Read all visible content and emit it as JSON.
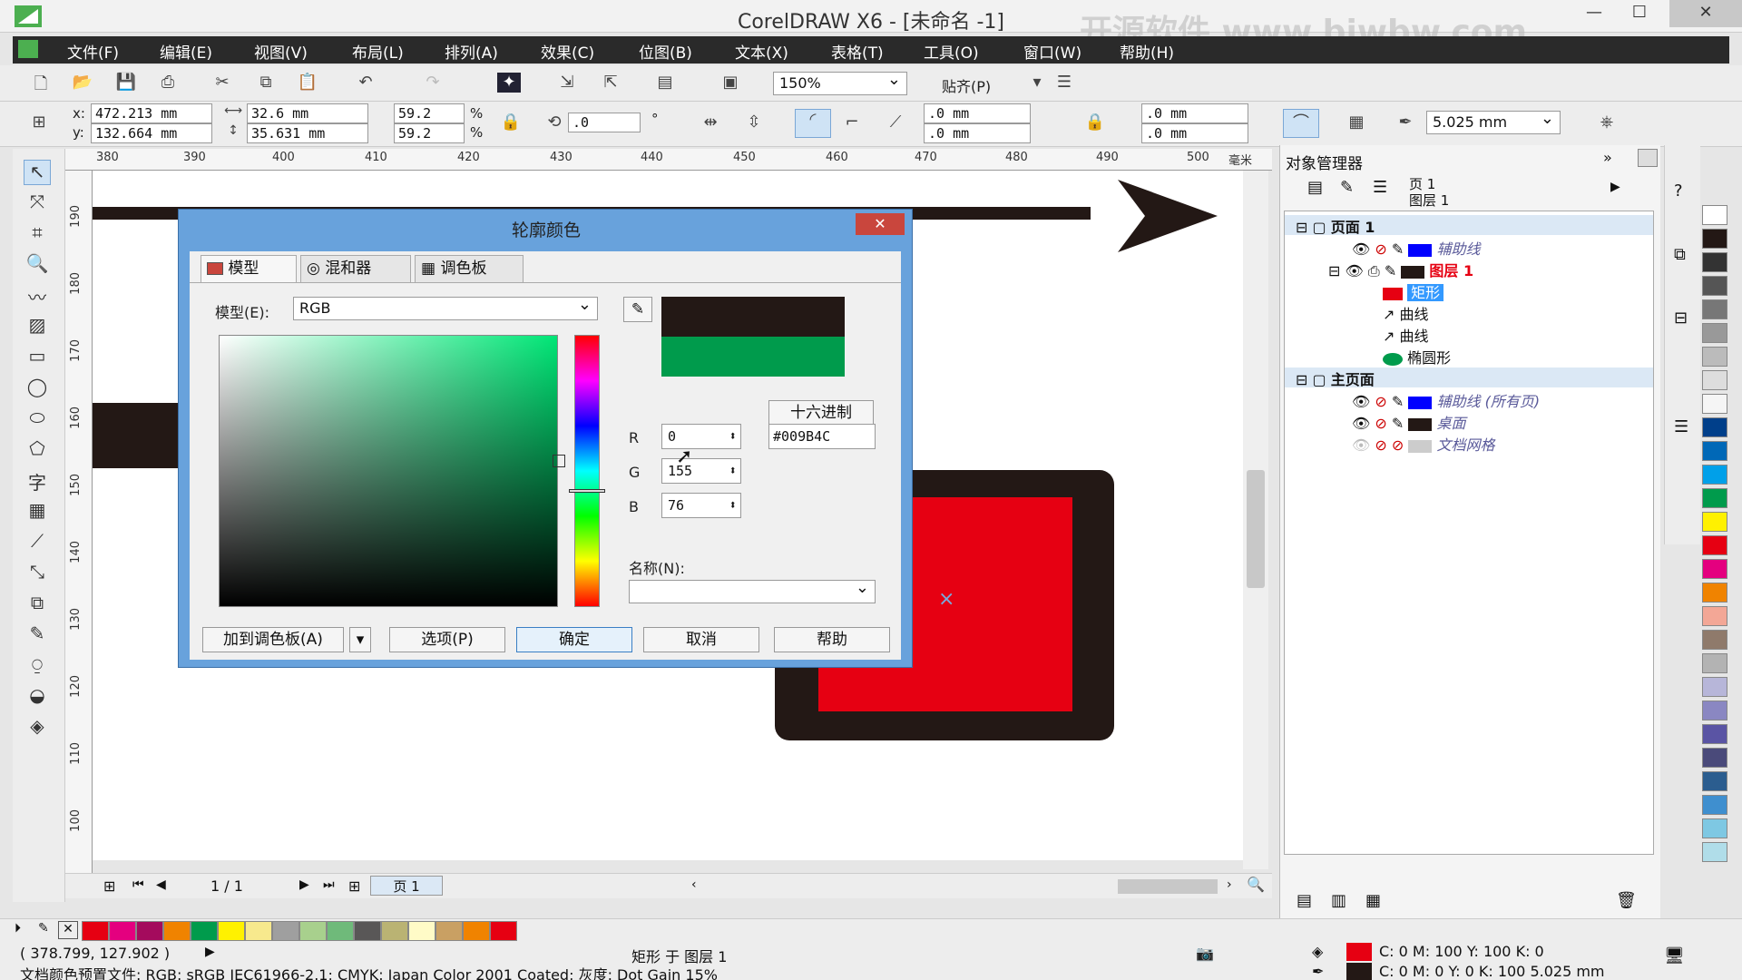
{
  "window": {
    "title": "CorelDRAW X6 - [未命名 -1]",
    "watermark": "开源软件 www.bjwbw.com"
  },
  "menu": [
    "文件(F)",
    "编辑(E)",
    "视图(V)",
    "布局(L)",
    "排列(A)",
    "效果(C)",
    "位图(B)",
    "文本(X)",
    "表格(T)",
    "工具(O)",
    "窗口(W)",
    "帮助(H)"
  ],
  "toolbar": {
    "zoom": "150%",
    "snap_label": "贴齐(P)"
  },
  "props": {
    "x": "472.213 mm",
    "y": "132.664 mm",
    "w": "32.6 mm",
    "h": "35.631 mm",
    "scale_x": "59.2",
    "scale_y": "59.2",
    "pct": "%",
    "angle": ".0",
    "deg": "°",
    "corner1": ".0 mm",
    "corner2": ".0 mm",
    "corner3": ".0 mm",
    "corner4": ".0 mm",
    "outline_width": "5.025 mm",
    "x_label": "x:",
    "y_label": "y:"
  },
  "ruler_h": [
    "380",
    "390",
    "400",
    "410",
    "420",
    "430",
    "440",
    "450",
    "460",
    "470",
    "480",
    "490",
    "500",
    "毫米"
  ],
  "ruler_v": [
    "190",
    "180",
    "170",
    "160",
    "150",
    "140",
    "130",
    "120",
    "110",
    "100"
  ],
  "dialog": {
    "title": "轮廓颜色",
    "tabs": [
      "模型",
      "混和器",
      "调色板"
    ],
    "model_label": "模型(E):",
    "model_value": "RGB",
    "hex_mode": "十六进制",
    "r_label": "R",
    "r_value": "0",
    "g_label": "G",
    "g_value": "155",
    "b_label": "B",
    "b_value": "76",
    "hex_value": "#009B4C",
    "name_label": "名称(N):",
    "add_palette": "加到调色板(A)",
    "options": "选项(P)",
    "ok": "确定",
    "cancel": "取消",
    "help": "帮助",
    "old_color": "#231815",
    "new_color": "#009B4C"
  },
  "object_manager": {
    "title": "对象管理器",
    "page_info": "页 1",
    "layer_info": "图层 1",
    "tree": [
      {
        "label": "页面 1",
        "level": 0,
        "style": "bold"
      },
      {
        "label": "辅助线",
        "level": 1,
        "style": "italic",
        "color": "#0000ff"
      },
      {
        "label": "图层 1",
        "level": 1,
        "style": "red",
        "color": "#231815"
      },
      {
        "label": "矩形",
        "level": 2,
        "style": "selected",
        "color": "#e60012"
      },
      {
        "label": "曲线",
        "level": 2,
        "style": "normal"
      },
      {
        "label": "曲线",
        "level": 2,
        "style": "normal"
      },
      {
        "label": "椭圆形",
        "level": 2,
        "style": "normal",
        "color": "#009b4c"
      },
      {
        "label": "主页面",
        "level": 0,
        "style": "bold"
      },
      {
        "label": "辅助线 (所有页)",
        "level": 1,
        "style": "italic",
        "color": "#0000ff"
      },
      {
        "label": "桌面",
        "level": 1,
        "style": "italic",
        "color": "#231815"
      },
      {
        "label": "文档网格",
        "level": 1,
        "style": "italic",
        "color": "#cccccc"
      }
    ]
  },
  "pagenav": {
    "counter": "1 / 1",
    "page_tab": "页 1"
  },
  "status": {
    "coords": "( 378.799, 127.902 )",
    "selection": "矩形 于 图层 1",
    "fill": "C: 0 M: 100 Y: 100 K: 0",
    "outline": "C: 0 M: 0 Y: 0 K: 100  5.025 mm",
    "profile": "文档颜色预置文件: RGB: sRGB IEC61966-2.1; CMYK: Japan Color 2001 Coated; 灰度: Dot Gain 15%"
  },
  "colors": {
    "red": "#e60012",
    "black": "#231815",
    "green": "#009b4c",
    "blue": "#0000ff",
    "palette_v": [
      "#ffffff",
      "#231815",
      "#333333",
      "#555555",
      "#777777",
      "#999999",
      "#bbbbbb",
      "#dddddd",
      "#f5f5f5",
      "#003f8a",
      "#0068b7",
      "#00a0e9",
      "#009b4c",
      "#fff100",
      "#e60012",
      "#e4007f",
      "#f08300",
      "#f3a796",
      "#8f7a6b",
      "#b3b3b3",
      "#b7b6d9",
      "#8a87c2",
      "#5a54a4",
      "#4a4a7a",
      "#2b5d8f",
      "#3f8fcf",
      "#7ec8e3",
      "#b0dde9"
    ],
    "palette_h": [
      "#e60012",
      "#e4007f",
      "#a40b5d",
      "#f08300",
      "#009b4c",
      "#fff100",
      "#f7e98d",
      "#9f9f9f",
      "#a8d08d",
      "#6fba7a",
      "#595757",
      "#bab373",
      "#fffbc7",
      "#c9a063",
      "#f08300",
      "#e60012"
    ]
  }
}
